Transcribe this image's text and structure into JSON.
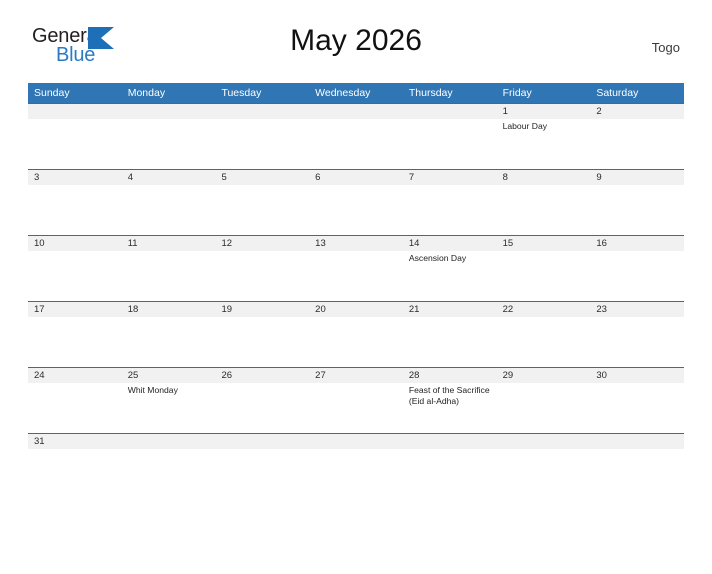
{
  "brand": {
    "word_one": "General",
    "word_two": "Blue",
    "triangle_color": "#1d70b8",
    "text_color": "#231f20"
  },
  "header": {
    "title": "May 2026",
    "country": "Togo"
  },
  "theme": {
    "header_blue": "#3075b4",
    "row_border_blue": "#2e6fa8",
    "band_gray": "#f1f1f1"
  },
  "calendar": {
    "weekdays": [
      "Sunday",
      "Monday",
      "Tuesday",
      "Wednesday",
      "Thursday",
      "Friday",
      "Saturday"
    ],
    "weeks": [
      [
        {
          "day": "",
          "events": []
        },
        {
          "day": "",
          "events": []
        },
        {
          "day": "",
          "events": []
        },
        {
          "day": "",
          "events": []
        },
        {
          "day": "",
          "events": []
        },
        {
          "day": "1",
          "events": [
            "Labour Day"
          ]
        },
        {
          "day": "2",
          "events": []
        }
      ],
      [
        {
          "day": "3",
          "events": []
        },
        {
          "day": "4",
          "events": []
        },
        {
          "day": "5",
          "events": []
        },
        {
          "day": "6",
          "events": []
        },
        {
          "day": "7",
          "events": []
        },
        {
          "day": "8",
          "events": []
        },
        {
          "day": "9",
          "events": []
        }
      ],
      [
        {
          "day": "10",
          "events": []
        },
        {
          "day": "11",
          "events": []
        },
        {
          "day": "12",
          "events": []
        },
        {
          "day": "13",
          "events": []
        },
        {
          "day": "14",
          "events": [
            "Ascension Day"
          ]
        },
        {
          "day": "15",
          "events": []
        },
        {
          "day": "16",
          "events": []
        }
      ],
      [
        {
          "day": "17",
          "events": []
        },
        {
          "day": "18",
          "events": []
        },
        {
          "day": "19",
          "events": []
        },
        {
          "day": "20",
          "events": []
        },
        {
          "day": "21",
          "events": []
        },
        {
          "day": "22",
          "events": []
        },
        {
          "day": "23",
          "events": []
        }
      ],
      [
        {
          "day": "24",
          "events": []
        },
        {
          "day": "25",
          "events": [
            "Whit Monday"
          ]
        },
        {
          "day": "26",
          "events": []
        },
        {
          "day": "27",
          "events": []
        },
        {
          "day": "28",
          "events": [
            "Feast of the Sacrifice (Eid al-Adha)"
          ]
        },
        {
          "day": "29",
          "events": []
        },
        {
          "day": "30",
          "events": []
        }
      ],
      [
        {
          "day": "31",
          "events": []
        },
        {
          "day": "",
          "events": []
        },
        {
          "day": "",
          "events": []
        },
        {
          "day": "",
          "events": []
        },
        {
          "day": "",
          "events": []
        },
        {
          "day": "",
          "events": []
        },
        {
          "day": "",
          "events": []
        }
      ]
    ]
  }
}
